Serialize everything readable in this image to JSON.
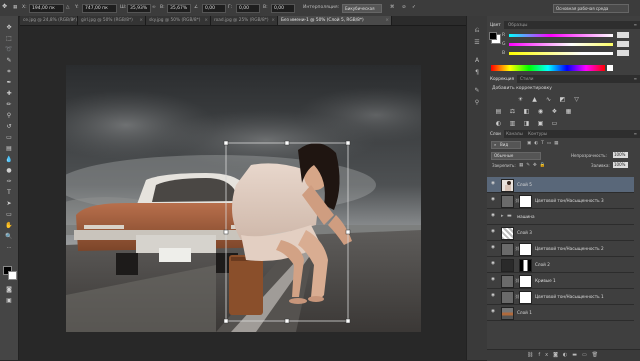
{
  "options_bar": {
    "x_label": "X:",
    "x_value": "194,00 пк",
    "y_label": "Y:",
    "y_value": "747,00 пк",
    "w_label": "Ш:",
    "w_value": "35,93%",
    "h_label": "В:",
    "h_value": "35,67%",
    "angle_value": "0,00",
    "h_skew_label": "Г:",
    "h_skew_value": "0,00",
    "v_skew_label": "В:",
    "v_skew_value": "0,00",
    "interp_label": "Интерполяция:",
    "interp_value": "Бикубическая",
    "workspace": "Основная рабочая среда"
  },
  "tabs": [
    {
      "label": "се.jpg @ 24,8% (RGB/8*)",
      "active": false
    },
    {
      "label": "girl.jpg @ 50% (RGB/8*)",
      "active": false
    },
    {
      "label": "sky.jpg @ 50% (RGB/8*)",
      "active": false
    },
    {
      "label": "road.jpg @ 25% (RGB/8*)",
      "active": false
    },
    {
      "label": "Без имени-1 @ 50% (Слой 5, RGB/8*)",
      "active": true
    }
  ],
  "color_panel": {
    "tabs": [
      "Цвет",
      "Образцы"
    ],
    "sliders": [
      {
        "label": "R",
        "value": ""
      },
      {
        "label": "G",
        "value": ""
      },
      {
        "label": "B",
        "value": ""
      }
    ]
  },
  "adjustments_panel": {
    "tabs": [
      "Коррекция",
      "Стили"
    ],
    "title": "Добавить корректировку"
  },
  "layers_panel": {
    "tabs": [
      "Слои",
      "Каналы",
      "Контуры"
    ],
    "filter_label": "Вид",
    "blend_mode": "Обычные",
    "opacity_label": "Непрозрачность:",
    "opacity_value": "100%",
    "lock_label": "Закрепить:",
    "fill_label": "Заливка:",
    "fill_value": "100%",
    "layers": [
      {
        "name": "Слой 5",
        "selected": true,
        "type": "image"
      },
      {
        "name": "Цветовой тон/Насыщенность 3",
        "selected": false,
        "type": "adjust"
      },
      {
        "name": "машина",
        "selected": false,
        "type": "folder"
      },
      {
        "name": "Слой 3",
        "selected": false,
        "type": "pattern"
      },
      {
        "name": "Цветовой тон/Насыщенность 2",
        "selected": false,
        "type": "adjust"
      },
      {
        "name": "Слой 2",
        "selected": false,
        "type": "dark"
      },
      {
        "name": "Кривые 1",
        "selected": false,
        "type": "curves"
      },
      {
        "name": "Цветовой тон/Насыщенность 1",
        "selected": false,
        "type": "adjust"
      },
      {
        "name": "Слой 1",
        "selected": false,
        "type": "road"
      }
    ]
  }
}
